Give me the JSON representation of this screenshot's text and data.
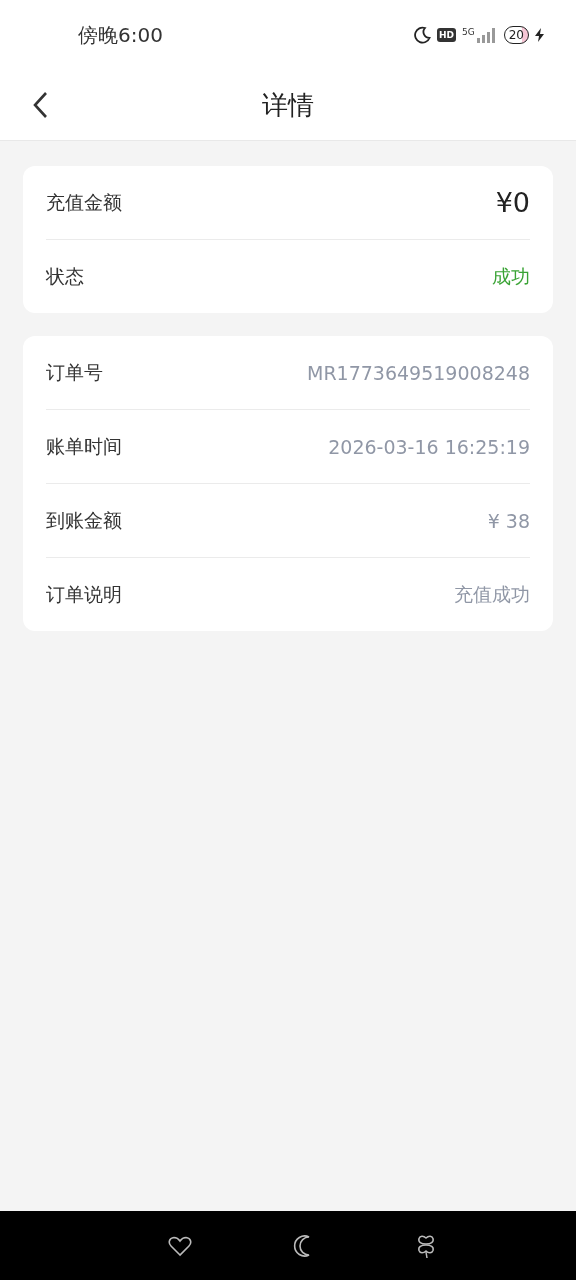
{
  "status_bar": {
    "time": "傍晚6:00",
    "hd": "HD",
    "network": "5G",
    "battery": "20"
  },
  "header": {
    "title": "详情"
  },
  "cards": [
    {
      "rows": [
        {
          "label": "充值金额",
          "value": "¥0",
          "kind": "amount"
        },
        {
          "label": "状态",
          "value": "成功",
          "kind": "status"
        }
      ]
    },
    {
      "rows": [
        {
          "label": "订单号",
          "value": "MR1773649519008248",
          "kind": "detail"
        },
        {
          "label": "账单时间",
          "value": "2026-03-16 16:25:19",
          "kind": "detail"
        },
        {
          "label": "到账金额",
          "value": "¥ 38",
          "kind": "detail"
        },
        {
          "label": "订单说明",
          "value": "充值成功",
          "kind": "detail"
        }
      ]
    }
  ]
}
